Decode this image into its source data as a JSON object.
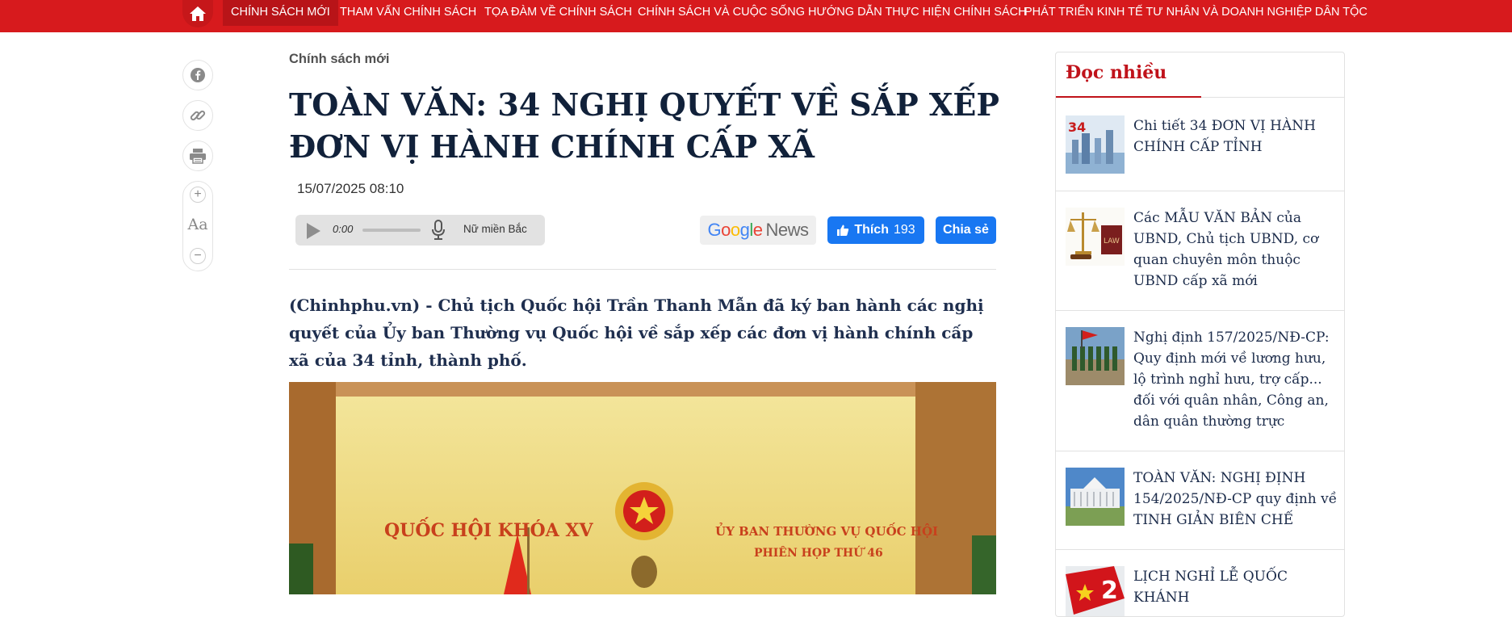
{
  "nav": {
    "items": [
      "CHÍNH SÁCH MỚI",
      "THAM VẤN CHÍNH SÁCH",
      "TỌA ĐÀM VỀ CHÍNH SÁCH",
      "CHÍNH SÁCH VÀ CUỘC SỐNG",
      "HƯỚNG DẪN THỰC HIỆN CHÍNH SÁCH",
      "PHÁT TRIỂN KINH TẾ TƯ NHÂN VÀ DOANH NGHIỆP DÂN TỘC"
    ],
    "active_index": 0,
    "home_icon": "home-icon"
  },
  "share": {
    "icons": [
      "facebook-icon",
      "link-icon",
      "print-icon"
    ],
    "font_increase": "+",
    "font_label": "Aa",
    "font_decrease": "−"
  },
  "article": {
    "breadcrumb": "Chính sách mới",
    "title": "TOÀN VĂN: 34 NGHỊ QUYẾT VỀ SẮP XẾP ĐƠN VỊ HÀNH CHÍNH CẤP XÃ",
    "date": "15/07/2025 08:10",
    "lead": "(Chinhphu.vn) - Chủ tịch Quốc hội Trần Thanh Mẫn đã ký ban hành các nghị quyết của Ủy ban Thường vụ Quốc hội về sắp xếp các đơn vị hành chính cấp xã của 34 tỉnh, thành phố."
  },
  "audio": {
    "time": "0:00",
    "voice": "Nữ miền Bắc",
    "progress": 0
  },
  "social": {
    "google": "Google",
    "news": "News",
    "like_label": "Thích",
    "like_count": "193",
    "share_label": "Chia sẻ"
  },
  "photo": {
    "left_text": "QUỐC HỘI KHÓA XV",
    "right_line1": "ỦY BAN THƯỜNG VỤ QUỐC HỘI",
    "right_line2": "PHIÊN HỌP THỨ 46"
  },
  "sidebar": {
    "title": "Đọc nhiều",
    "items": [
      {
        "text": "Chi tiết 34 ĐƠN VỊ HÀNH CHÍNH CẤP TỈNH",
        "thumb_text": "34"
      },
      {
        "text": "Các MẪU VĂN BẢN của UBND, Chủ tịch UBND, cơ quan chuyên môn thuộc UBND cấp xã mới",
        "thumb_text": "LAW"
      },
      {
        "text": "Nghị định 157/2025/NĐ-CP: Quy định mới về lương hưu, lộ trình nghỉ hưu, trợ cấp... đối với quân nhân, Công an, dân quân thường trực",
        "thumb_text": ""
      },
      {
        "text": "TOÀN VĂN: NGHỊ ĐỊNH 154/2025/NĐ-CP quy định về TINH GIẢN BIÊN CHẾ",
        "thumb_text": ""
      },
      {
        "text": "LỊCH NGHỈ LỄ QUỐC KHÁNH",
        "thumb_text": "2"
      }
    ]
  },
  "colors": {
    "brand_red": "#d71a1d",
    "title_navy": "#11213a",
    "facebook_blue": "#1877f2"
  }
}
